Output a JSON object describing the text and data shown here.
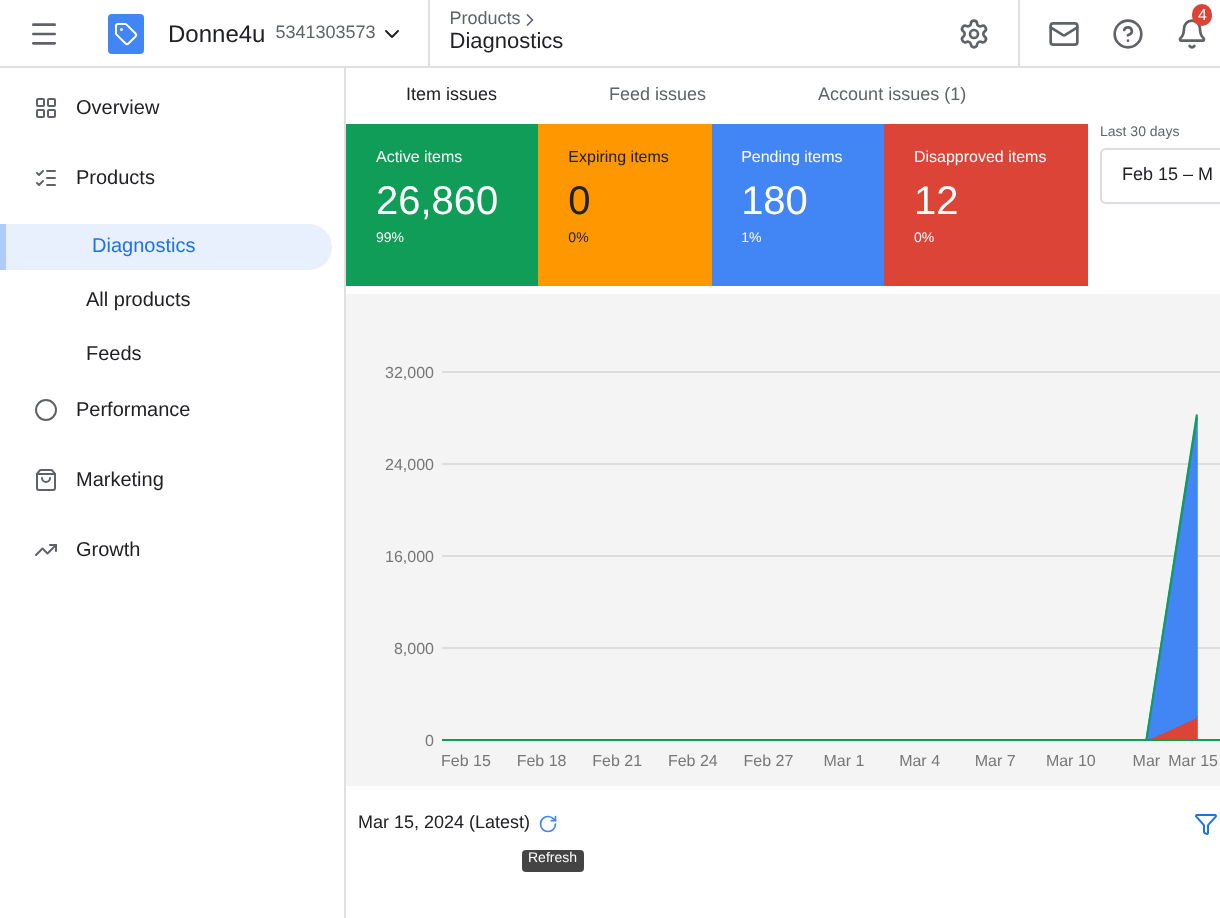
{
  "header": {
    "account_name": "Donne4u",
    "account_id": "5341303573",
    "breadcrumb": "Products",
    "page_title": "Diagnostics",
    "notification_badge": "4"
  },
  "sidebar": {
    "items": [
      {
        "label": "Overview",
        "kind": "section",
        "selected": false
      },
      {
        "label": "Products",
        "kind": "section",
        "selected": false
      },
      {
        "label": "Diagnostics",
        "kind": "sub",
        "selected": true
      },
      {
        "label": "All products",
        "kind": "sub",
        "selected": false
      },
      {
        "label": "Feeds",
        "kind": "sub",
        "selected": false
      },
      {
        "label": "Performance",
        "kind": "section",
        "selected": false
      },
      {
        "label": "Marketing",
        "kind": "section",
        "selected": false
      },
      {
        "label": "Growth",
        "kind": "section",
        "selected": false
      }
    ]
  },
  "tabs": [
    {
      "label": "Item issues",
      "selected": true
    },
    {
      "label": "Feed issues",
      "selected": false
    },
    {
      "label": "Account issues (1)",
      "selected": false
    }
  ],
  "cards": [
    {
      "label": "Active items",
      "value": "26,860",
      "percent": "99%",
      "color": "#0f9d58"
    },
    {
      "label": "Expiring items",
      "value": "0",
      "percent": "0%",
      "color": "#ff9800"
    },
    {
      "label": "Pending items",
      "value": "180",
      "percent": "1%",
      "color": "#4285f4"
    },
    {
      "label": "Disapproved items",
      "value": "12",
      "percent": "0%",
      "color": "#db4437"
    }
  ],
  "date_range": {
    "label": "Last 30 days",
    "value": "Feb 15 – M"
  },
  "chart": {
    "chart_data": {
      "type": "area",
      "stacked": true,
      "grid": true,
      "x": [
        "Feb 15",
        "Feb 18",
        "Feb 21",
        "Feb 24",
        "Feb 27",
        "Mar 1",
        "Mar 4",
        "Mar 7",
        "Mar 10",
        "Mar",
        "Mar 15"
      ],
      "series": [
        {
          "color": "#db4437",
          "values": [
            0,
            0,
            0,
            0,
            0,
            0,
            0,
            0,
            0,
            0,
            2000
          ]
        },
        {
          "color": "#4285f4",
          "values": [
            0,
            0,
            0,
            0,
            0,
            0,
            0,
            0,
            0,
            0,
            26000
          ]
        },
        {
          "color": "#0f9d58",
          "values": [
            0,
            0,
            0,
            0,
            0,
            0,
            0,
            0,
            0,
            0,
            300
          ]
        }
      ],
      "ylim": [
        0,
        32000
      ],
      "yticks": [
        {
          "value": 0,
          "label": "0"
        },
        {
          "value": 8000,
          "label": "8,000"
        },
        {
          "value": 16000,
          "label": "16,000"
        },
        {
          "value": 24000,
          "label": "24,000"
        },
        {
          "value": 32000,
          "label": "32,000"
        }
      ]
    }
  },
  "footer": {
    "snapshot_date": "Mar 15, 2024 (Latest)",
    "tooltip": "Refresh"
  }
}
